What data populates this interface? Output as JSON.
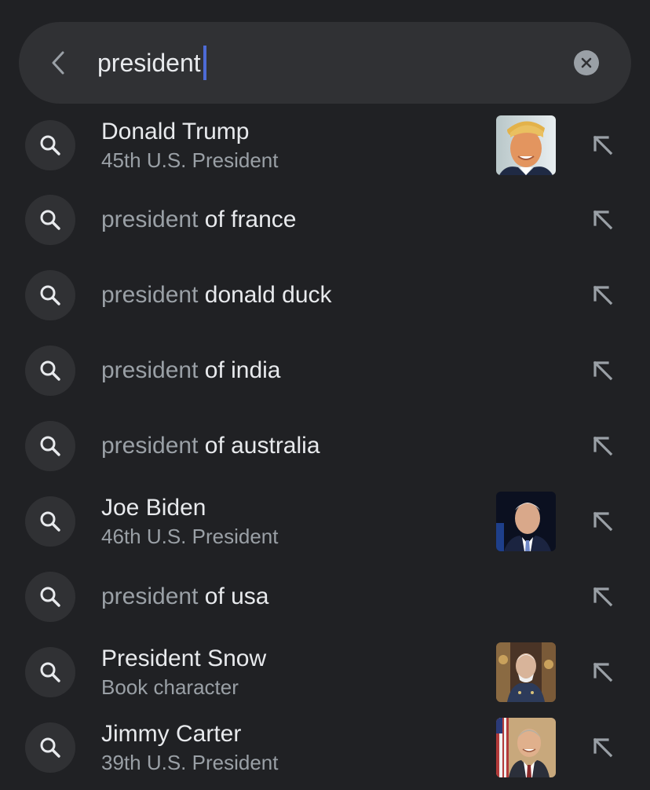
{
  "search": {
    "query": "president"
  },
  "suggestions": [
    {
      "title": "Donald Trump",
      "subtitle": "45th U.S. President"
    },
    {
      "prefix": "president",
      "suffix": " of france"
    },
    {
      "prefix": "president",
      "suffix": " donald duck"
    },
    {
      "prefix": "president",
      "suffix": " of india"
    },
    {
      "prefix": "president",
      "suffix": " of australia"
    },
    {
      "title": "Joe Biden",
      "subtitle": "46th U.S. President"
    },
    {
      "prefix": "president",
      "suffix": " of usa"
    },
    {
      "title": "President Snow",
      "subtitle": "Book character"
    },
    {
      "title": "Jimmy Carter",
      "subtitle": "39th U.S. President"
    }
  ],
  "icons": {
    "back": "chevron-left-icon",
    "clear": "clear-circle-icon",
    "search": "search-icon",
    "fill": "arrow-up-left-icon"
  },
  "colors": {
    "background": "#202124",
    "surface": "#303134",
    "text": "#e8eaed",
    "muted": "#9aa0a6",
    "caret": "#4d6bd6"
  }
}
